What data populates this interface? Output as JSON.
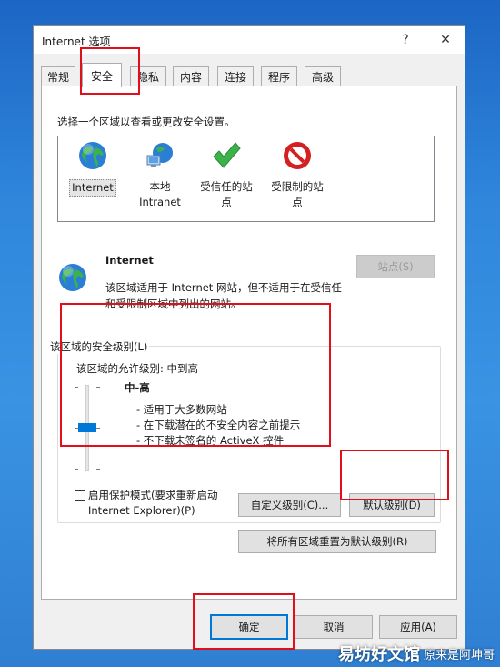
{
  "window": {
    "title": "Internet 选项",
    "help": "?",
    "close": "✕"
  },
  "tabs": [
    {
      "label": "常规"
    },
    {
      "label": "安全"
    },
    {
      "label": "隐私"
    },
    {
      "label": "内容"
    },
    {
      "label": "连接"
    },
    {
      "label": "程序"
    },
    {
      "label": "高级"
    }
  ],
  "security": {
    "zone_prompt": "选择一个区域以查看或更改安全设置。",
    "zones": [
      {
        "line1": "Internet",
        "line2": "",
        "icon": "globe-icon"
      },
      {
        "line1": "本地",
        "line2": "Intranet",
        "icon": "intranet-icon"
      },
      {
        "line1": "受信任的站",
        "line2": "点",
        "icon": "checkmark-icon"
      },
      {
        "line1": "受限制的站",
        "line2": "点",
        "icon": "restricted-icon"
      }
    ],
    "selected_zone": {
      "name": "Internet",
      "description_line1": "该区域适用于 Internet 网站，但不适用于在受信任",
      "description_line2": "和受限制区域中列出的网站。"
    },
    "sites_button": "站点(S)",
    "level_group_title": "该区域的安全级别(L)",
    "allowed_levels": "该区域的允许级别: 中到高",
    "level_name": "中-高",
    "level_details": [
      "- 适用于大多数网站",
      "- 在下载潜在的不安全内容之前提示",
      "- 不下载未签名的 ActiveX 控件"
    ],
    "protected_mode_line1": "启用保护模式(要求重新启动",
    "protected_mode_line2": "Internet Explorer)(P)",
    "protected_mode_checked": false,
    "custom_level_button": "自定义级别(C)...",
    "default_level_button": "默认级别(D)",
    "reset_all_button": "将所有区域重置为默认级别(R)"
  },
  "footer": {
    "ok": "确定",
    "cancel": "取消",
    "apply": "应用(A)"
  },
  "watermark": {
    "line1": "易坊好文馆",
    "line2": "原来是阿坤哥"
  },
  "colors": {
    "highlight_box": "#e0101a",
    "accent": "#0078d7",
    "desktop": "#2f86db"
  }
}
